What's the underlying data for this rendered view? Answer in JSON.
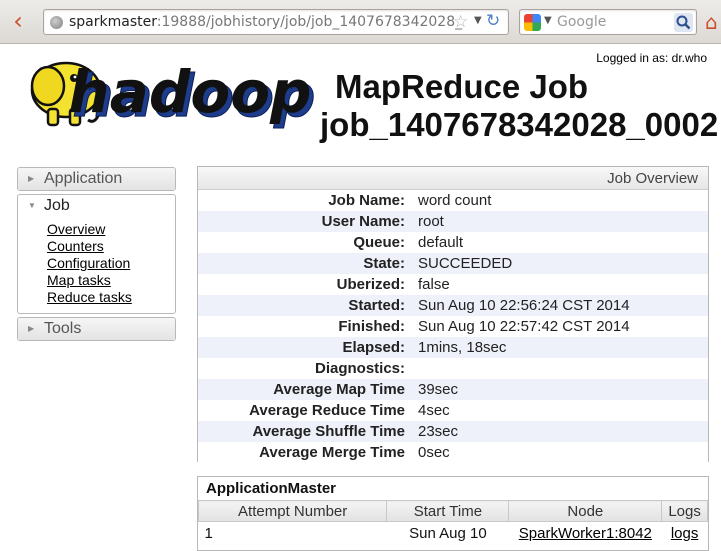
{
  "browser": {
    "url_host": "sparkmaster",
    "url_path": ":19888/jobhistory/job/job_1407678342028_",
    "search_placeholder": "Google"
  },
  "header": {
    "logged_in": "Logged in as: dr.who",
    "title_line1": "MapReduce Job",
    "title_line2": "job_1407678342028_0002",
    "logo_text": "hadoop"
  },
  "sidebar": {
    "sections": [
      {
        "label": "Application"
      },
      {
        "label": "Job",
        "links": [
          "Overview",
          "Counters",
          "Configuration",
          "Map tasks",
          "Reduce tasks"
        ]
      },
      {
        "label": "Tools"
      }
    ]
  },
  "overview": {
    "heading": "Job Overview",
    "rows": [
      {
        "label": "Job Name:",
        "value": "word count"
      },
      {
        "label": "User Name:",
        "value": "root"
      },
      {
        "label": "Queue:",
        "value": "default"
      },
      {
        "label": "State:",
        "value": "SUCCEEDED"
      },
      {
        "label": "Uberized:",
        "value": "false"
      },
      {
        "label": "Started:",
        "value": "Sun Aug 10 22:56:24 CST 2014"
      },
      {
        "label": "Finished:",
        "value": "Sun Aug 10 22:57:42 CST 2014"
      },
      {
        "label": "Elapsed:",
        "value": "1mins, 18sec"
      },
      {
        "label": "Diagnostics:",
        "value": ""
      },
      {
        "label": "Average Map Time",
        "value": "39sec"
      },
      {
        "label": "Average Reduce Time",
        "value": "4sec"
      },
      {
        "label": "Average Shuffle Time",
        "value": "23sec"
      },
      {
        "label": "Average Merge Time",
        "value": "0sec"
      }
    ]
  },
  "app_master": {
    "title": "ApplicationMaster",
    "columns": [
      "Attempt Number",
      "Start Time",
      "Node",
      "Logs"
    ],
    "row": {
      "attempt": "1",
      "start": "Sun Aug 10",
      "node": "SparkWorker1:8042",
      "logs": "logs"
    }
  },
  "colors": {
    "accent": "#c8502a",
    "row_alt": "#eef0fa",
    "border": "#b8b8b8"
  }
}
